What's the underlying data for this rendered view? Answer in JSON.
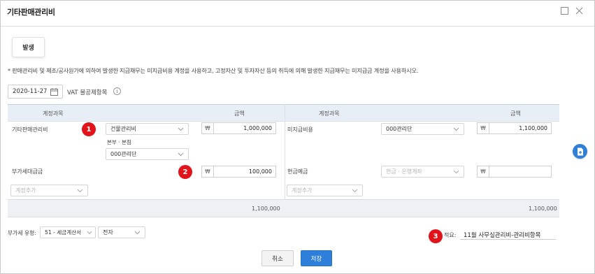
{
  "window": {
    "title": "기타판매관리비"
  },
  "tab": {
    "label": "발생"
  },
  "notice": "* 판매관리비 및 제조/공사원가에 의하여 발생한 지급채무는 미지급비용 계정을 사용하고, 고정자산 및 투자자산 등의 취득에 의해 발생한 지급채무는 미지급금 계정을 사용하시오.",
  "date": {
    "value": "2020-11-27",
    "vat_exempt_label": "VAT 불공제항목",
    "info_glyph": "i"
  },
  "table": {
    "left": {
      "header_account": "계정과목",
      "header_amount": "금액",
      "rows": [
        {
          "account": "기타판매관리비",
          "select_value": "건물관리비",
          "sub_label": "본부 · 본점",
          "sub_select_value": "000관리단",
          "currency": "₩",
          "amount": "1,000,000"
        },
        {
          "account": "부가세대급금",
          "currency": "₩",
          "amount": "100,000"
        }
      ],
      "add_account_placeholder": "계정추가",
      "total": "1,100,000"
    },
    "right": {
      "header_account": "계정과목",
      "header_amount": "금액",
      "rows": [
        {
          "account": "미지급비용",
          "select_value": "000관리단",
          "currency": "₩",
          "amount": "1,100,000"
        },
        {
          "account": "현금예금",
          "select_placeholder": "현금 · 은행계좌",
          "currency": "₩",
          "amount": ""
        }
      ],
      "add_account_placeholder": "계정추가",
      "total": "1,100,000"
    }
  },
  "footer": {
    "vat_type_label": "부가세 유형:",
    "vat_type_value": "51 - 세금계산서",
    "vat_method_value": "전자",
    "memo_label": "적요:",
    "memo_value": "11월 사무실관리비-관리비항목"
  },
  "buttons": {
    "cancel": "취소",
    "save": "저장"
  },
  "badges": [
    "1",
    "2",
    "3"
  ],
  "colors": {
    "badge": "#e0141a",
    "primary": "#2e7fd9",
    "table_header": "#e8eef6"
  },
  "icons": {
    "minimize": "minimize-icon",
    "close": "close-icon",
    "calendar": "calendar-icon",
    "chevron": "chevron-down-icon",
    "document": "document-icon"
  }
}
